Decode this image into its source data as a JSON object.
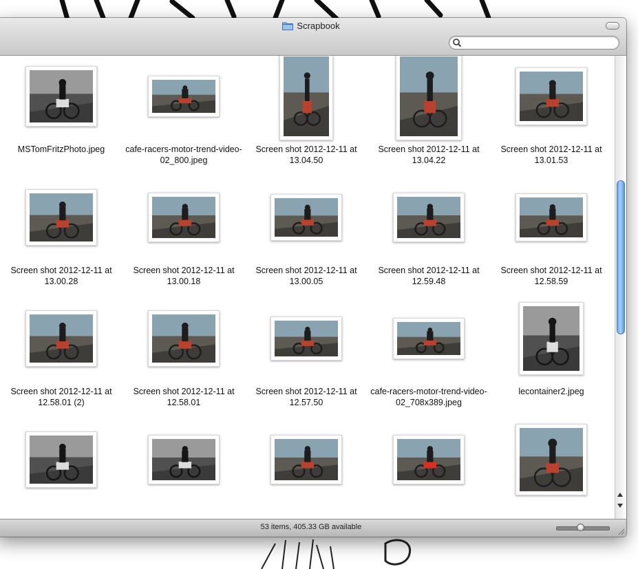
{
  "window": {
    "title": "Scrapbook",
    "icon": "folder-icon"
  },
  "search": {
    "value": "",
    "placeholder": "",
    "icon": "search-icon"
  },
  "files": [
    {
      "name": "MSTomFritzPhoto.jpeg",
      "bw": true
    },
    {
      "name": "cafe-racers-motor-trend-video-02_800.jpeg",
      "bw": false
    },
    {
      "name": "Screen shot 2012-12-11 at 13.04.50",
      "bw": false
    },
    {
      "name": "Screen shot 2012-12-11 at 13.04.22",
      "bw": false
    },
    {
      "name": "Screen shot 2012-12-11 at 13.01.53",
      "bw": false
    },
    {
      "name": "Screen shot 2012-12-11 at 13.00.28",
      "bw": false
    },
    {
      "name": "Screen shot 2012-12-11 at 13.00.18",
      "bw": false
    },
    {
      "name": "Screen shot 2012-12-11 at 13.00.05",
      "bw": false
    },
    {
      "name": "Screen shot 2012-12-11 at 12.59.48",
      "bw": false
    },
    {
      "name": "Screen shot 2012-12-11 at 12.58.59",
      "bw": false
    },
    {
      "name": "Screen shot 2012-12-11 at 12.58.01 (2)",
      "bw": false
    },
    {
      "name": "Screen shot 2012-12-11 at 12.58.01",
      "bw": false
    },
    {
      "name": "Screen shot 2012-12-11 at 12.57.50",
      "bw": false
    },
    {
      "name": "cafe-racers-motor-trend-video-02_708x389.jpeg",
      "bw": false
    },
    {
      "name": "lecontainer2.jpeg",
      "bw": true
    },
    {
      "name": "",
      "bw": true
    },
    {
      "name": "",
      "bw": true
    },
    {
      "name": "",
      "bw": false
    },
    {
      "name": "",
      "bw": false
    },
    {
      "name": "",
      "bw": false
    }
  ],
  "status": {
    "text": "53 items, 405.33 GB available"
  },
  "zoom": {
    "level": 0.45
  },
  "colors": {
    "scroll_thumb": "#6ea6e8",
    "chrome": "#c9c9c9"
  }
}
